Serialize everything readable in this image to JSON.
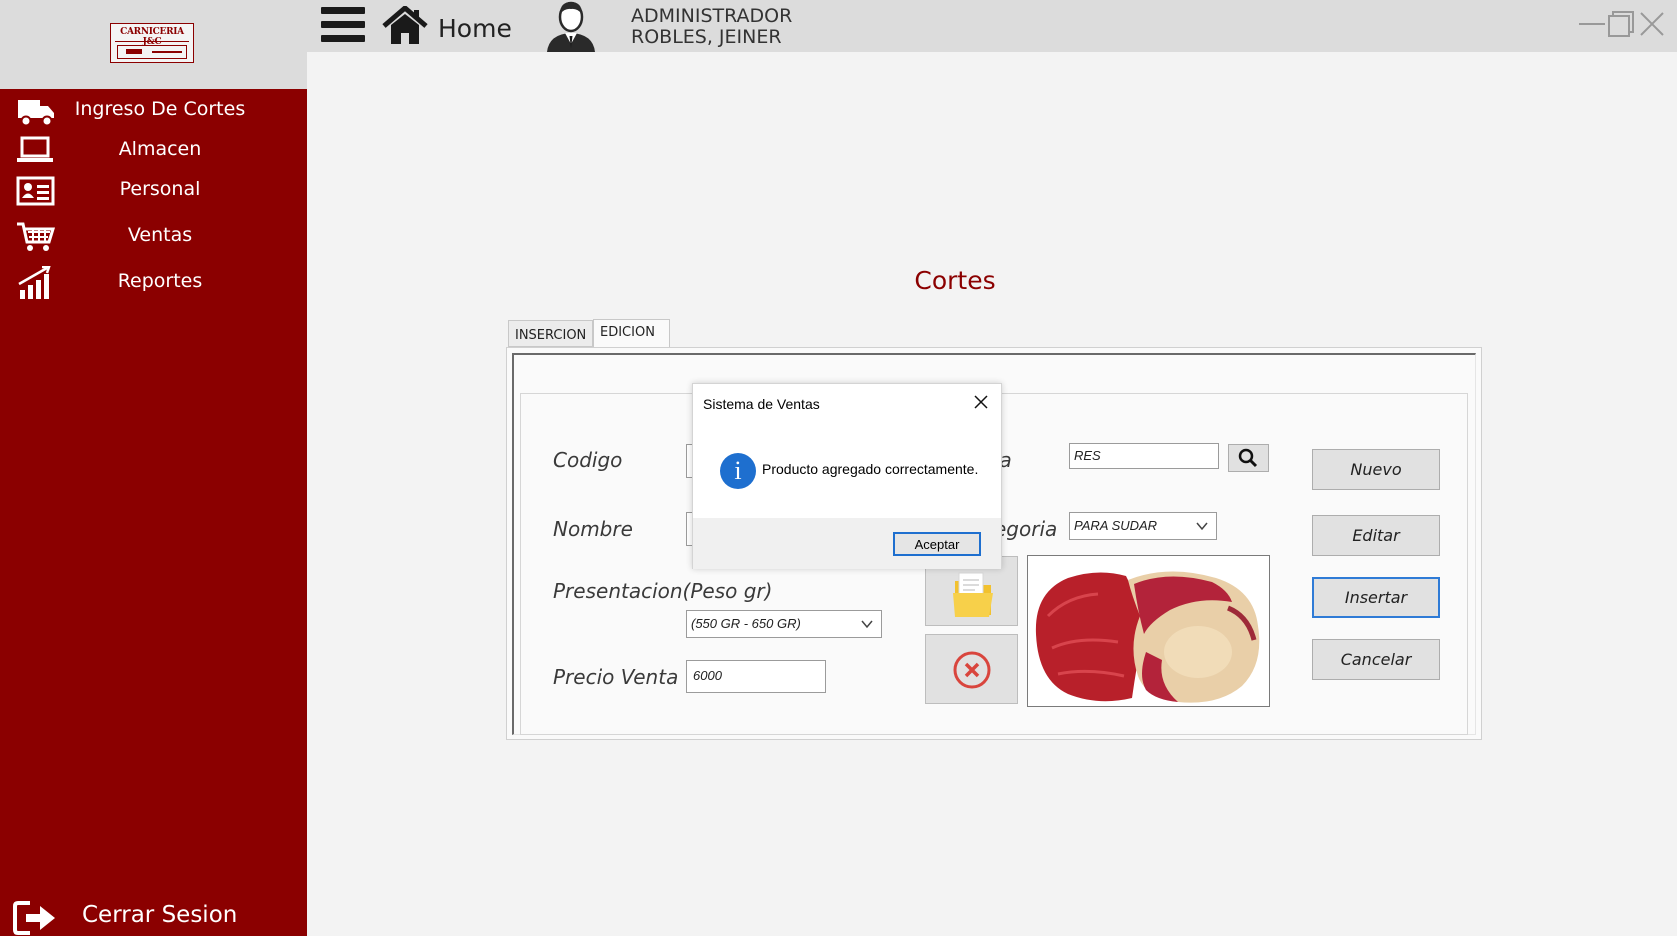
{
  "app": {
    "logo_text": "CARNICERIA J&C",
    "brand_color": "#8b0000"
  },
  "sidebar": {
    "items": [
      {
        "label": "Ingreso De Cortes",
        "icon": "truck-icon"
      },
      {
        "label": "Almacen",
        "icon": "laptop-icon"
      },
      {
        "label": "Personal",
        "icon": "id-card-icon"
      },
      {
        "label": "Ventas",
        "icon": "cart-icon"
      },
      {
        "label": "Reportes",
        "icon": "bar-chart-icon"
      }
    ],
    "logout_label": "Cerrar Sesion"
  },
  "topbar": {
    "home_label": "Home",
    "user_role": "ADMINISTRADOR",
    "user_name": "ROBLES, JEINER"
  },
  "main": {
    "title": "Cortes",
    "tabs": [
      {
        "label": "INSERCION"
      },
      {
        "label": "EDICION"
      }
    ],
    "form": {
      "codigo_label": "Codigo",
      "codigo_value": "",
      "nombre_label": "Nombre",
      "nombre_value": "",
      "presentacion_label": "Presentacion(Peso gr)",
      "presentacion_value": "(550 GR - 650 GR)",
      "precio_label": "Precio Venta",
      "precio_value": "6000",
      "categoria_label_partial": "ia",
      "categoria_value": "RES",
      "subcategoria_label_partial": "egoria",
      "subcategoria_value": "PARA SUDAR"
    },
    "buttons": {
      "nuevo": "Nuevo",
      "editar": "Editar",
      "insertar": "Insertar",
      "cancelar": "Cancelar"
    }
  },
  "dialog": {
    "title": "Sistema de Ventas",
    "message": "Producto agregado correctamente.",
    "ok_label": "Aceptar"
  }
}
